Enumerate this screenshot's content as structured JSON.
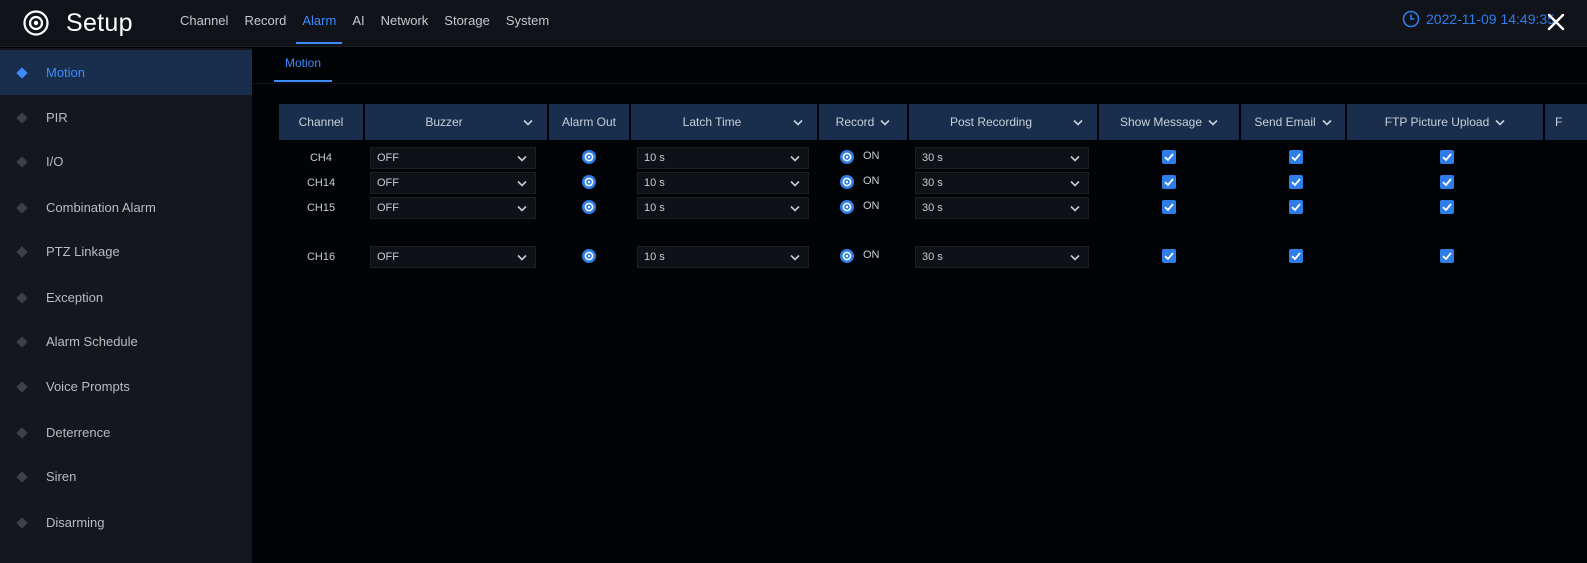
{
  "header": {
    "title": "Setup",
    "logo_icon": "gear-icon",
    "menu": [
      "Channel",
      "Record",
      "Alarm",
      "AI",
      "Network",
      "Storage",
      "System"
    ],
    "active_menu": "Alarm",
    "datetime": "2022-11-09 14:49:35",
    "accent": "#3d8bff"
  },
  "sidebar": {
    "items": [
      {
        "label": "Motion"
      },
      {
        "label": "PIR"
      },
      {
        "label": "I/O"
      },
      {
        "label": "Combination Alarm"
      },
      {
        "label": "PTZ Linkage"
      },
      {
        "label": "Exception"
      },
      {
        "label": "Alarm Schedule"
      },
      {
        "label": "Voice Prompts"
      },
      {
        "label": "Deterrence"
      },
      {
        "label": "Siren"
      },
      {
        "label": "Disarming"
      }
    ],
    "active_index": 0
  },
  "subtabs": [
    {
      "label": "Motion"
    }
  ],
  "table": {
    "headers": [
      "Channel",
      "Buzzer",
      "Alarm Out",
      "Latch Time",
      "Record",
      "Post Recording",
      "Show Message",
      "Send Email",
      "FTP Picture Upload",
      "F"
    ],
    "rows": [
      {
        "channel": "CH4",
        "buzzer": "OFF",
        "latch": "10 s",
        "record": "ON",
        "post": "30 s",
        "show_message": true,
        "send_email": true,
        "ftp_upload": true
      },
      {
        "channel": "CH14",
        "buzzer": "OFF",
        "latch": "10 s",
        "record": "ON",
        "post": "30 s",
        "show_message": true,
        "send_email": true,
        "ftp_upload": true
      },
      {
        "channel": "CH15",
        "buzzer": "OFF",
        "latch": "10 s",
        "record": "ON",
        "post": "30 s",
        "show_message": true,
        "send_email": true,
        "ftp_upload": true
      },
      {
        "channel": "CH16",
        "buzzer": "OFF",
        "latch": "10 s",
        "record": "ON",
        "post": "30 s",
        "show_message": true,
        "send_email": true,
        "ftp_upload": true
      }
    ]
  }
}
